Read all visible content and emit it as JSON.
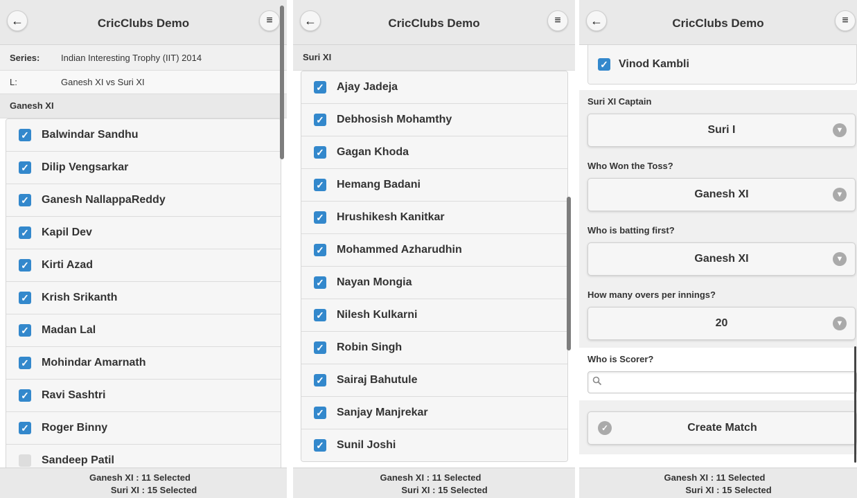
{
  "app": {
    "title": "CricClubs Demo",
    "back_icon": "←",
    "menu_icon": "≡"
  },
  "footer": {
    "line1": "Ganesh XI : 11 Selected",
    "line2": "Suri XI : 15 Selected"
  },
  "panel1": {
    "series_label": "Series:",
    "series_value": "Indian Interesting Trophy (IIT) 2014",
    "l_label": "L:",
    "l_value": "Ganesh XI vs Suri XI",
    "team_header": "Ganesh XI",
    "players": [
      {
        "name": "Balwindar Sandhu",
        "checked": true
      },
      {
        "name": "Dilip Vengsarkar",
        "checked": true
      },
      {
        "name": "Ganesh NallappaReddy",
        "checked": true
      },
      {
        "name": "Kapil Dev",
        "checked": true
      },
      {
        "name": "Kirti Azad",
        "checked": true
      },
      {
        "name": "Krish Srikanth",
        "checked": true
      },
      {
        "name": "Madan Lal",
        "checked": true
      },
      {
        "name": "Mohindar Amarnath",
        "checked": true
      },
      {
        "name": "Ravi Sashtri",
        "checked": true
      },
      {
        "name": "Roger Binny",
        "checked": true
      },
      {
        "name": "Sandeep Patil",
        "checked": false
      }
    ]
  },
  "panel2": {
    "team_header": "Suri XI",
    "players": [
      {
        "name": "Ajay Jadeja",
        "checked": true
      },
      {
        "name": "Debhosish Mohamthy",
        "checked": true
      },
      {
        "name": "Gagan Khoda",
        "checked": true
      },
      {
        "name": "Hemang Badani",
        "checked": true
      },
      {
        "name": "Hrushikesh Kanitkar",
        "checked": true
      },
      {
        "name": "Mohammed Azharudhin",
        "checked": true
      },
      {
        "name": "Nayan Mongia",
        "checked": true
      },
      {
        "name": "Nilesh Kulkarni",
        "checked": true
      },
      {
        "name": "Robin Singh",
        "checked": true
      },
      {
        "name": "Sairaj Bahutule",
        "checked": true
      },
      {
        "name": "Sanjay Manjrekar",
        "checked": true
      },
      {
        "name": "Sunil Joshi",
        "checked": true
      }
    ]
  },
  "panel3": {
    "last_player": {
      "name": "Vinod Kambli",
      "checked": true
    },
    "captain_label": "Suri XI Captain",
    "captain_value": "Suri I",
    "toss_label": "Who Won the Toss?",
    "toss_value": "Ganesh XI",
    "batting_label": "Who is batting first?",
    "batting_value": "Ganesh XI",
    "overs_label": "How many overs per innings?",
    "overs_value": "20",
    "scorer_label": "Who is Scorer?",
    "scorer_value": "",
    "create_label": "Create Match"
  },
  "colors": {
    "accent": "#3388cc",
    "header_bg": "#e9e9e9"
  }
}
